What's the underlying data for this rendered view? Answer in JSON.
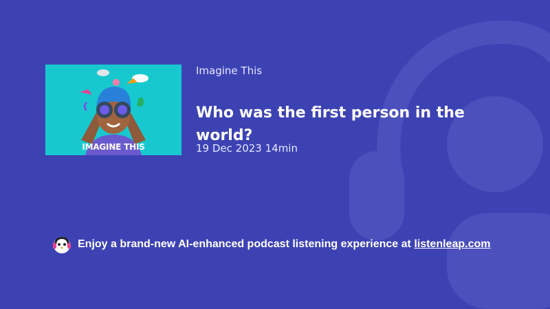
{
  "podcast": {
    "show_name": "Imagine This",
    "cover_text": "IMAGINE THIS",
    "episode_title": "Who was the first person in the world?",
    "date": "19 Dec 2023",
    "duration": "14min"
  },
  "promo": {
    "text": "Enjoy a brand-new AI-enhanced podcast listening experience at",
    "link_text": "listenleap.com"
  },
  "colors": {
    "background": "#3d42b3",
    "cover_background": "#17c9cf",
    "text": "#ffffff"
  },
  "icons": {
    "mascot": "penguin-headphones-icon",
    "background_logo": "headphones-logo"
  }
}
